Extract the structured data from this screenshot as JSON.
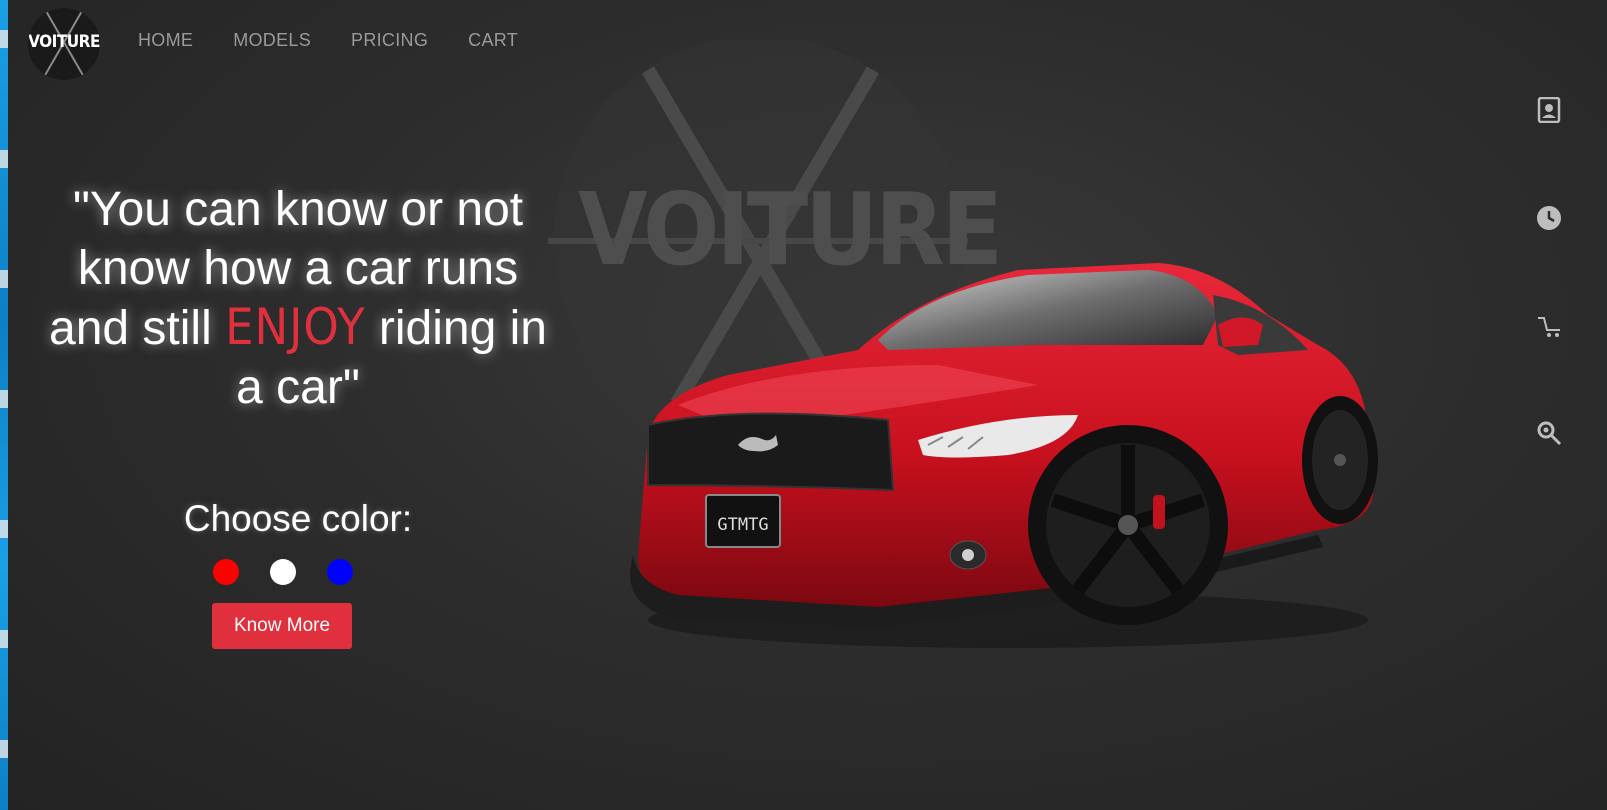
{
  "brand": {
    "logo_text": "VOITURE"
  },
  "nav": {
    "items": [
      "HOME",
      "MODELS",
      "PRICING",
      "CART"
    ]
  },
  "watermark": {
    "text": "VOITURE"
  },
  "hero": {
    "quote_part1": "\"You can know or not know how a car runs and still",
    "quote_highlight": "ENJOY",
    "quote_part2": "riding in a car\"",
    "choose_label": "Choose color:",
    "cta_label": "Know More"
  },
  "colors": {
    "swatches": [
      "#ff0000",
      "#ffffff",
      "#0000ff"
    ],
    "accent": "#e0303e"
  },
  "car": {
    "plate": "GTMTG"
  },
  "side_icons": [
    "contact-card-icon",
    "clock-icon",
    "cart-icon",
    "search-key-icon"
  ]
}
